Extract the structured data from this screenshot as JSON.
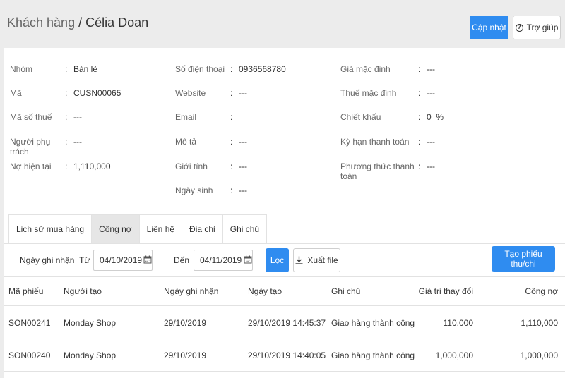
{
  "header": {
    "breadcrumb_parent": "Khách hàng",
    "separator": " / ",
    "customer_name": "Célia Doan",
    "update_label": "Cập nhật",
    "help_label": "Trợ giúp"
  },
  "info": {
    "col1": [
      {
        "label": "Nhóm",
        "value": "Bán lẻ"
      },
      {
        "label": "Mã",
        "value": "CUSN00065"
      },
      {
        "label": "Mã số thuế",
        "value": "---"
      },
      {
        "label": "Người phụ trách",
        "value": "---"
      },
      {
        "label": "Nợ hiện tại",
        "value": "1,110,000"
      }
    ],
    "col2": [
      {
        "label": "Số điện thoại",
        "value": "0936568780"
      },
      {
        "label": "Website",
        "value": "---"
      },
      {
        "label": "Email",
        "value": ""
      },
      {
        "label": "Mô tả",
        "value": "---"
      },
      {
        "label": "Giới tính",
        "value": "---"
      },
      {
        "label": "Ngày sinh",
        "value": "---"
      }
    ],
    "col3": [
      {
        "label": "Giá mặc định",
        "value": "---"
      },
      {
        "label": "Thuế mặc định",
        "value": "---"
      },
      {
        "label": "Chiết khấu",
        "value": "0  %"
      },
      {
        "label": "Kỳ hạn thanh toán",
        "value": "---"
      },
      {
        "label": "Phương thức thanh toán",
        "value": "---"
      }
    ],
    "colon": ":"
  },
  "tabs": [
    {
      "label": "Lịch sử mua hàng"
    },
    {
      "label": "Công nợ"
    },
    {
      "label": "Liên hệ"
    },
    {
      "label": "Địa chỉ"
    },
    {
      "label": "Ghi chú"
    }
  ],
  "filter": {
    "date_label": "Ngày ghi nhận",
    "from_label": "Từ",
    "from_value": "04/10/2019",
    "to_label": "Đến",
    "to_value": "04/11/2019",
    "filter_button": "Lọc",
    "export_button": "Xuất file",
    "create_button": "Tạo phiếu thu/chi"
  },
  "table": {
    "headers": [
      "Mã phiếu",
      "Người tạo",
      "Ngày ghi nhận",
      "Ngày tạo",
      "Ghi chú",
      "Giá trị thay đổi",
      "Công nợ"
    ],
    "rows": [
      [
        "SON00241",
        "Monday Shop",
        "29/10/2019",
        "29/10/2019 14:45:37",
        "Giao hàng thành công",
        "110,000",
        "1,110,000"
      ],
      [
        "SON00240",
        "Monday Shop",
        "29/10/2019",
        "29/10/2019 14:40:05",
        "Giao hàng thành công",
        "1,000,000",
        "1,000,000"
      ]
    ]
  },
  "colors": {
    "primary": "#2f8cf0",
    "background": "#ececec"
  }
}
